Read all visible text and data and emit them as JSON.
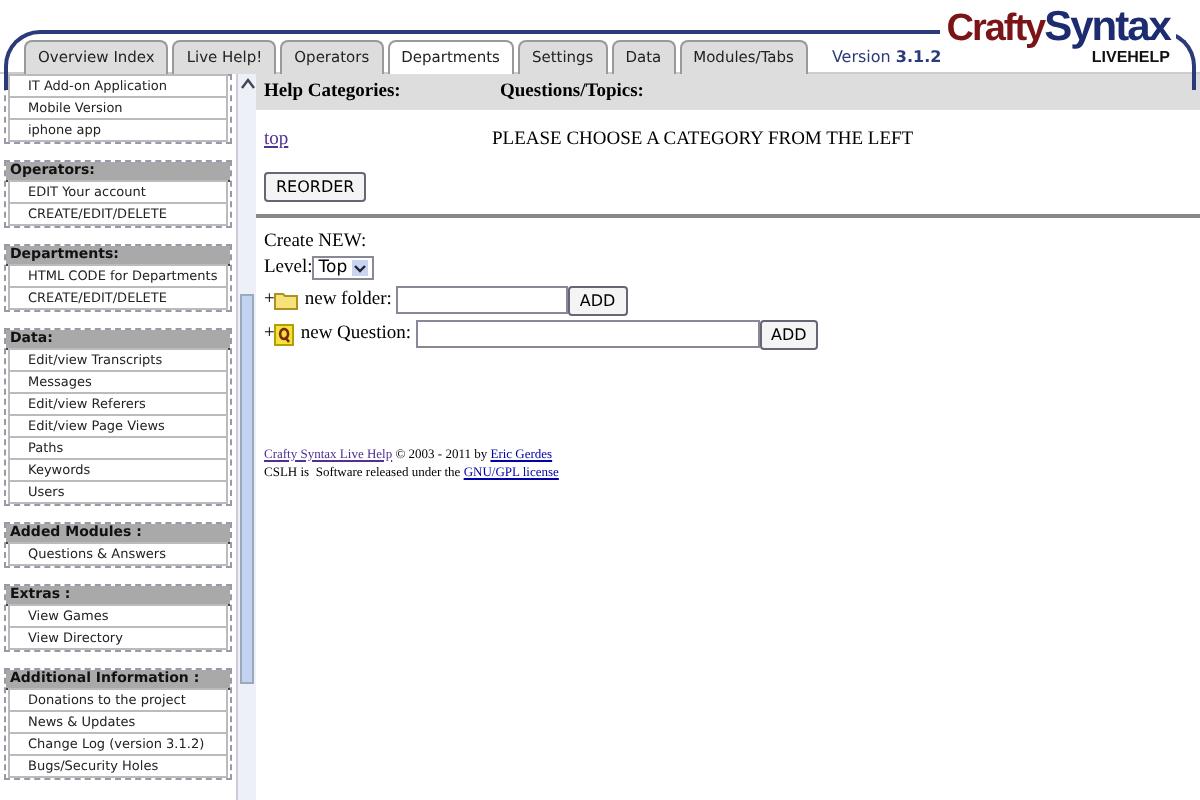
{
  "header": {
    "tabs": [
      {
        "label": "Overview Index",
        "selected": false
      },
      {
        "label": "Live Help!",
        "selected": false
      },
      {
        "label": "Operators",
        "selected": false
      },
      {
        "label": "Departments",
        "selected": true
      },
      {
        "label": "Settings",
        "selected": false
      },
      {
        "label": "Data",
        "selected": false
      },
      {
        "label": "Modules/Tabs",
        "selected": false
      }
    ],
    "version": "Version **3.1.2**",
    "logo": {
      "word_1": "Crafty",
      "word_2": "Syntax",
      "tagline": "LIVEHELP"
    }
  },
  "sidebar": {
    "sections": [
      {
        "items": [
          "IT Add-on Application",
          "Mobile Version",
          "iphone app"
        ]
      },
      {
        "heading": "Operators:",
        "items": [
          "EDIT Your account",
          "CREATE/EDIT/DELETE"
        ]
      },
      {
        "heading": "Departments:",
        "items": [
          "HTML CODE for Departments",
          "CREATE/EDIT/DELETE"
        ]
      },
      {
        "heading": "Data:",
        "items": [
          "Edit/view Transcripts",
          "Messages",
          "Edit/view Referers",
          "Edit/view Page Views",
          "Paths",
          "Keywords",
          "Users"
        ]
      },
      {
        "heading": "Added Modules :",
        "items": [
          "Questions & Answers"
        ]
      },
      {
        "heading": "Extras :",
        "items": [
          "View Games",
          "View Directory"
        ]
      },
      {
        "heading": "Additional Information :",
        "items": [
          "Donations to the project",
          "News & Updates",
          "Change Log (version 3.1.2)",
          "Bugs/Security Holes"
        ]
      }
    ]
  },
  "content": {
    "columns": [
      "Help Categories:",
      "Questions/Topics:"
    ],
    "category_link": "top",
    "message": "PLEASE CHOOSE A CATEGORY FROM THE LEFT",
    "reorder_button": "REORDER",
    "create_new_label": "Create NEW:",
    "level_label": "Level:",
    "level_value": "Top",
    "new_items": [
      {
        "kind": "folder",
        "prefix": "+",
        "label": "new folder:",
        "button": "ADD"
      },
      {
        "kind": "question",
        "prefix": "+",
        "label": "new Question:",
        "button": "ADD"
      }
    ],
    "footer": [
      [
        {
          "text": "Crafty Syntax Live Help",
          "link": true
        },
        {
          "text": " © 2003 - 2011 by ",
          "link": false
        },
        {
          "text": "Eric Gerdes",
          "link": true
        }
      ],
      [
        {
          "text": "CSLH is  Software released under the ",
          "link": false
        },
        {
          "text": "GNU/GPL license",
          "link": true
        }
      ]
    ]
  }
}
